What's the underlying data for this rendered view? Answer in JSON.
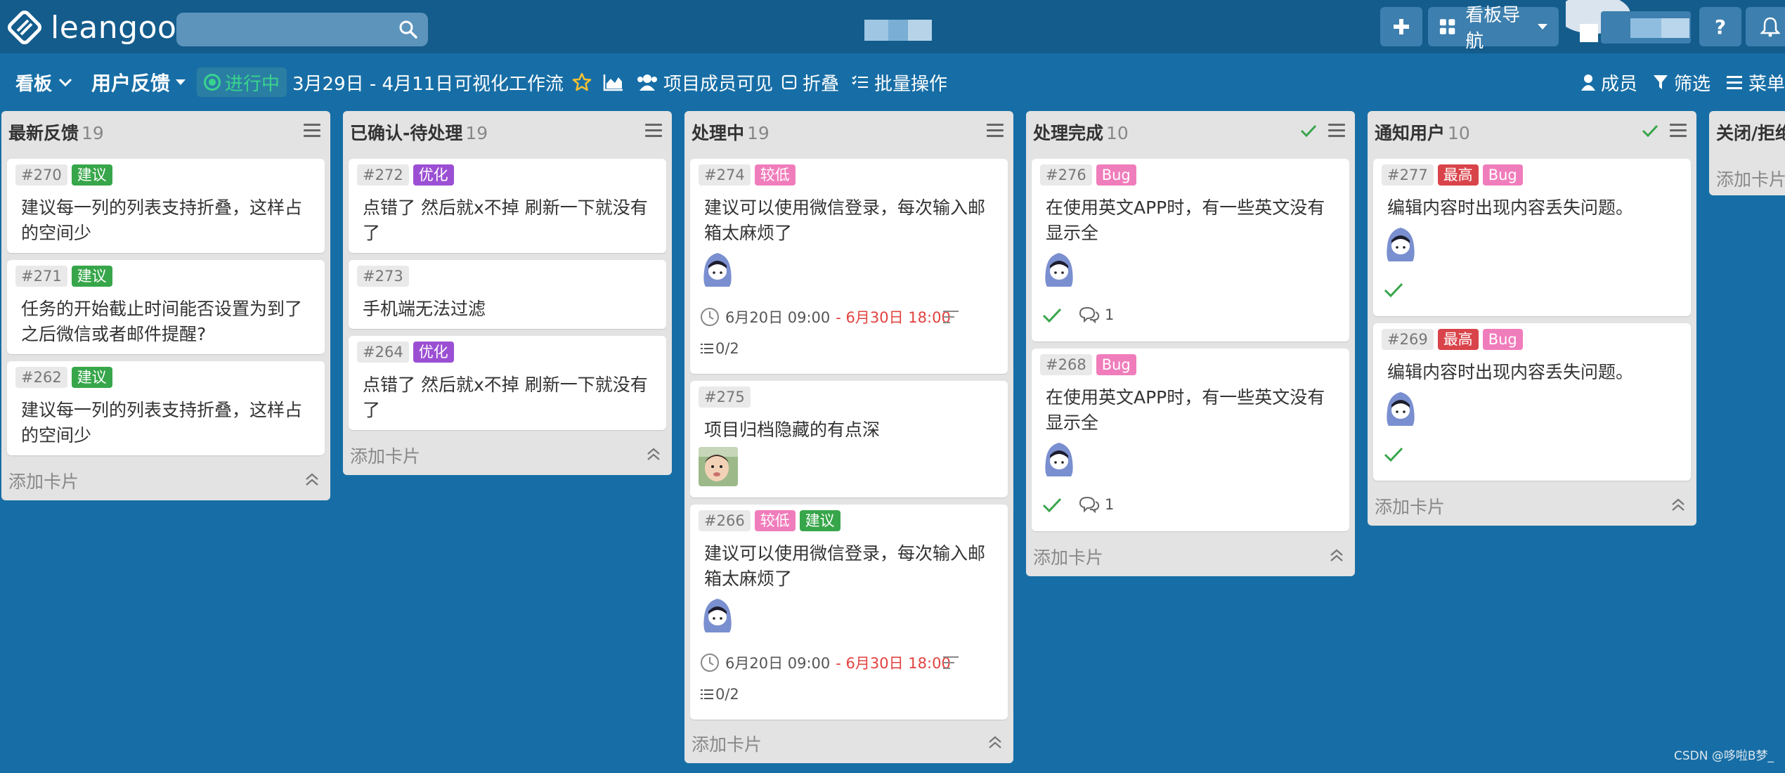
{
  "app": {
    "logo_text": "leangoo"
  },
  "topbar": {
    "search_placeholder": "",
    "board_nav_label": "看板导航",
    "help_label": "?"
  },
  "board": {
    "board_menu_label": "看板",
    "project_name": "用户反馈",
    "status": "进行中",
    "date_range": "3月29日 - 4月11日",
    "workflow_label": "可视化工作流",
    "visibility_label": "项目成员可见",
    "fold_label": "折叠",
    "batch_label": "批量操作",
    "members_label": "成员",
    "filter_label": "筛选",
    "menu_label": "菜单"
  },
  "lists": [
    {
      "title": "最新反馈",
      "count": "19",
      "add_card": "添加卡片",
      "cards": [
        {
          "id": "#270",
          "tags": [
            "建议"
          ],
          "title": "建议每一列的列表支持折叠，这样占的空间少"
        },
        {
          "id": "#271",
          "tags": [
            "建议"
          ],
          "title": "任务的开始截止时间能否设置为到了之后微信或者邮件提醒?"
        },
        {
          "id": "#262",
          "tags": [
            "建议"
          ],
          "title": "建议每一列的列表支持折叠，这样占的空间少"
        }
      ]
    },
    {
      "title": "已确认-待处理",
      "count": "19",
      "add_card": "添加卡片",
      "cards": [
        {
          "id": "#272",
          "tags": [
            "优化"
          ],
          "title": "点错了  然后就x不掉  刷新一下就没有了"
        },
        {
          "id": "#273",
          "tags": [],
          "title": "手机端无法过滤"
        },
        {
          "id": "#264",
          "tags": [
            "优化"
          ],
          "title": "点错了  然后就x不掉  刷新一下就没有了"
        }
      ]
    },
    {
      "title": "处理中",
      "count": "19",
      "add_card": "添加卡片",
      "cards": [
        {
          "id": "#274",
          "tags": [
            "较低"
          ],
          "title": "建议可以使用微信登录，每次输入邮箱太麻烦了",
          "due_start": "6月20日 09:00",
          "due_end": "- 6月30日 18:00",
          "checklist": "0/2"
        },
        {
          "id": "#275",
          "tags": [],
          "title": "项目归档隐藏的有点深"
        },
        {
          "id": "#266",
          "tags": [
            "较低",
            "建议"
          ],
          "title": "建议可以使用微信登录，每次输入邮箱太麻烦了",
          "due_start": "6月20日 09:00",
          "due_end": "- 6月30日 18:00",
          "checklist": "0/2"
        }
      ]
    },
    {
      "title": "处理完成",
      "count": "10",
      "add_card": "添加卡片",
      "cards": [
        {
          "id": "#276",
          "tags": [
            "Bug"
          ],
          "title": "在使用英文APP时，有一些英文没有显示全",
          "comments": "1"
        },
        {
          "id": "#268",
          "tags": [
            "Bug"
          ],
          "title": "在使用英文APP时，有一些英文没有显示全",
          "comments": "1"
        }
      ]
    },
    {
      "title": "通知用户",
      "count": "10",
      "add_card": "添加卡片",
      "cards": [
        {
          "id": "#277",
          "tags": [
            "最高",
            "Bug"
          ],
          "title": "编辑内容时出现内容丢失问题。"
        },
        {
          "id": "#269",
          "tags": [
            "最高",
            "Bug"
          ],
          "title": "编辑内容时出现内容丢失问题。"
        }
      ]
    },
    {
      "title": "关闭/拒绝",
      "count": "",
      "add_card": "添加卡片",
      "cards": []
    }
  ],
  "watermark": "CSDN @哆啦B梦_",
  "colors": {
    "background": "#176ea6",
    "topbar": "#135c8c",
    "tag_green": "#37a64a",
    "tag_purple": "#9b4fd3",
    "tag_pink": "#f07dbb",
    "tag_red": "#d9434a",
    "status_green": "#38d48d",
    "late_red": "#e2423f"
  }
}
